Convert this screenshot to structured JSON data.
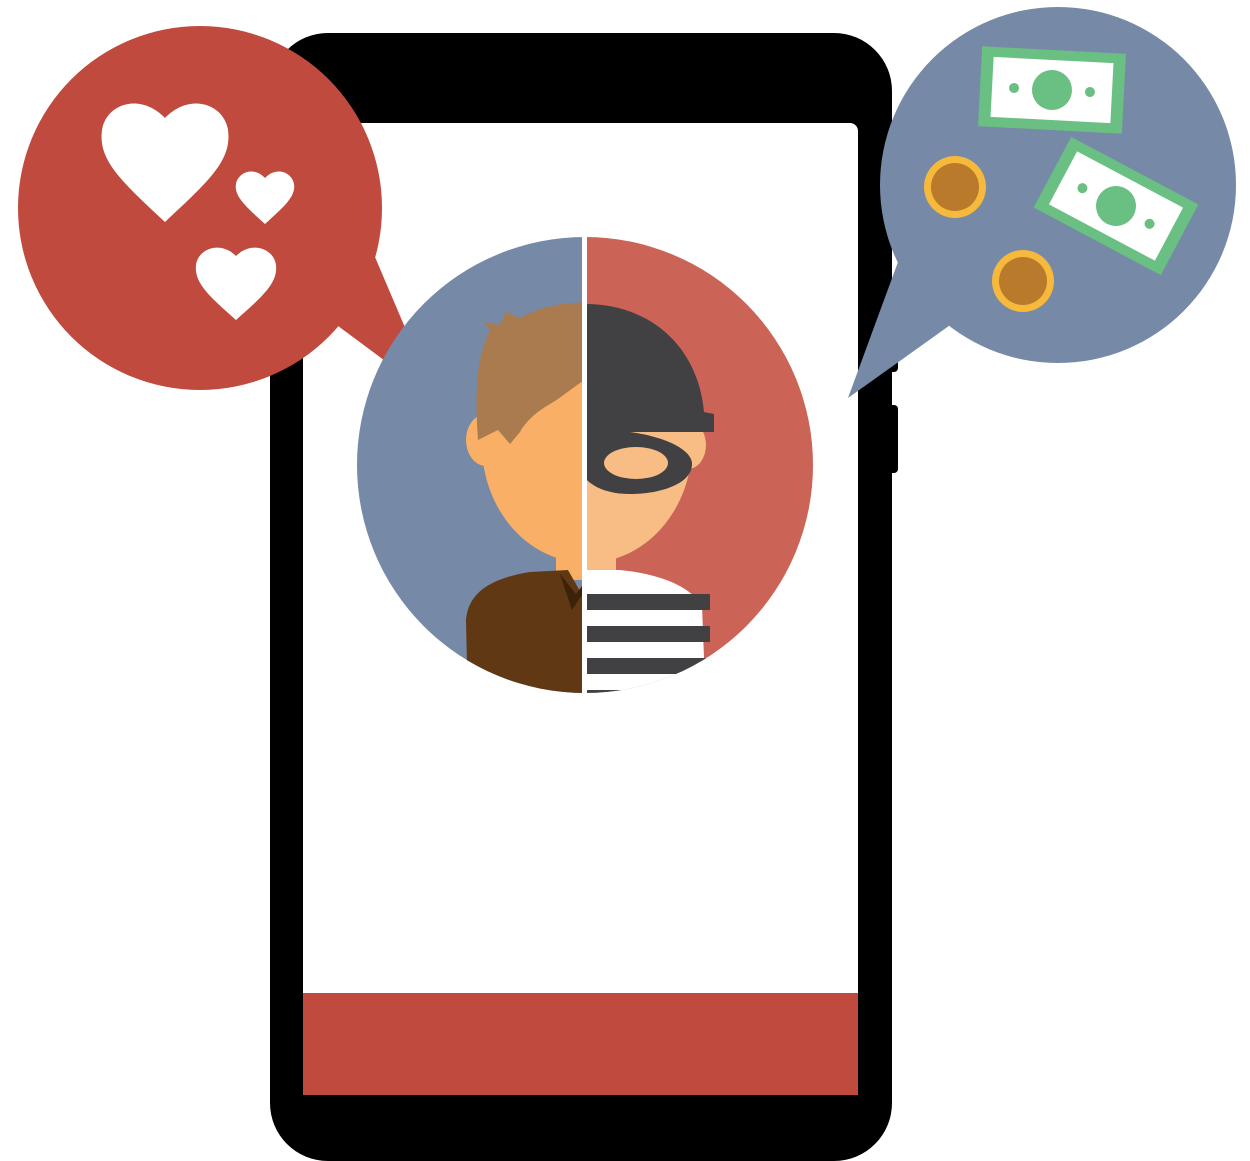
{
  "scene": {
    "colors": {
      "phone_body": "#000000",
      "screen": "#ffffff",
      "bottom_bar": "#c04a3e",
      "love_bubble": "#c04a3e",
      "money_bubble": "#7689a6",
      "avatar_left_bg": "#7689a6",
      "avatar_right_bg": "#cb6457",
      "skin": "#f9b066",
      "hair": "#a97b4f",
      "jacket": "#603813",
      "mask": "#414042",
      "bill": "#6abf82",
      "coin": "#b97a2b"
    },
    "icons": {
      "love_bubble": "heart-icons",
      "money_bubble": "cash-and-coins-icons",
      "avatar": "person-and-thief-split-avatar"
    }
  }
}
